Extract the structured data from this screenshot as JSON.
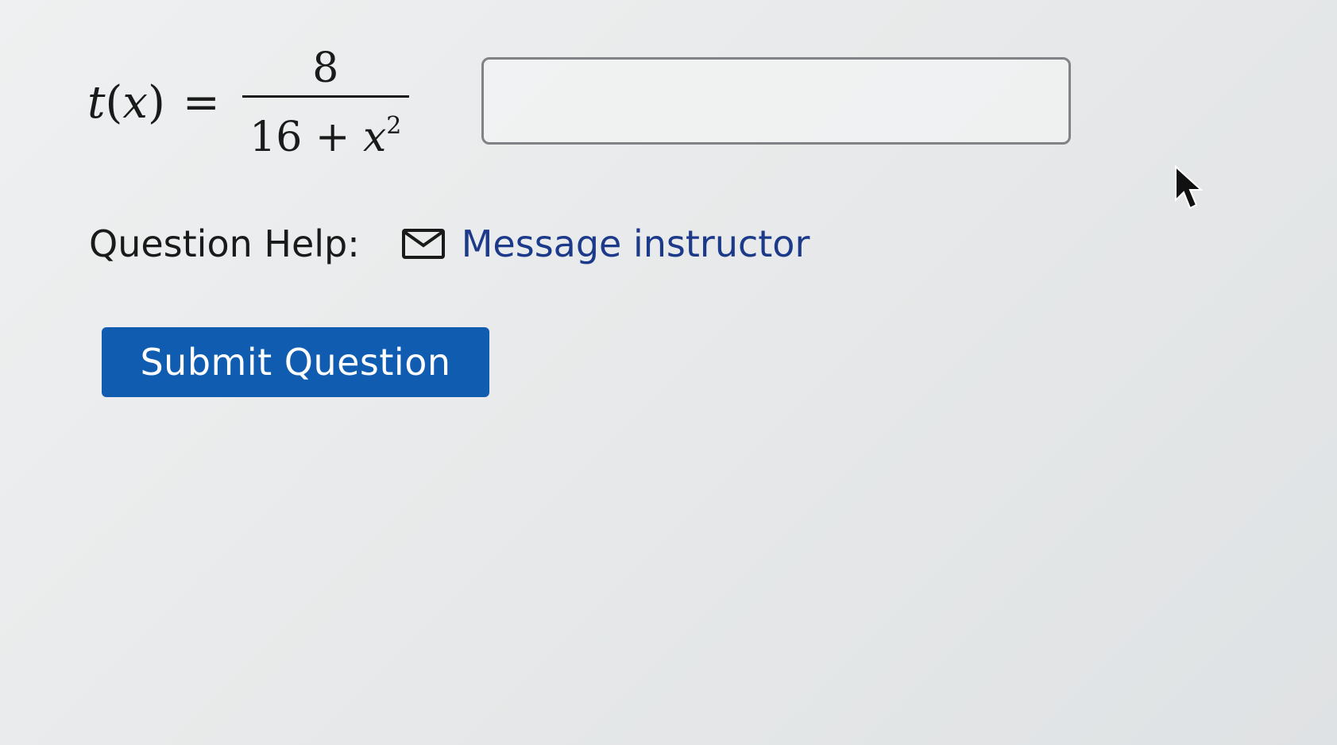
{
  "question": {
    "lhs_func": "t",
    "lhs_var": "x",
    "equals": "=",
    "numerator": "8",
    "denominator_const": "16",
    "denominator_op": "+",
    "denominator_var": "x",
    "denominator_exp": "2"
  },
  "answer": {
    "value": ""
  },
  "help": {
    "label": "Question Help:",
    "link_icon": "mail-icon",
    "link_text": "Message instructor"
  },
  "actions": {
    "submit_label": "Submit Question"
  },
  "colors": {
    "link": "#1d3a8a",
    "button_bg": "#0f5cb0",
    "button_text": "#ffffff"
  }
}
